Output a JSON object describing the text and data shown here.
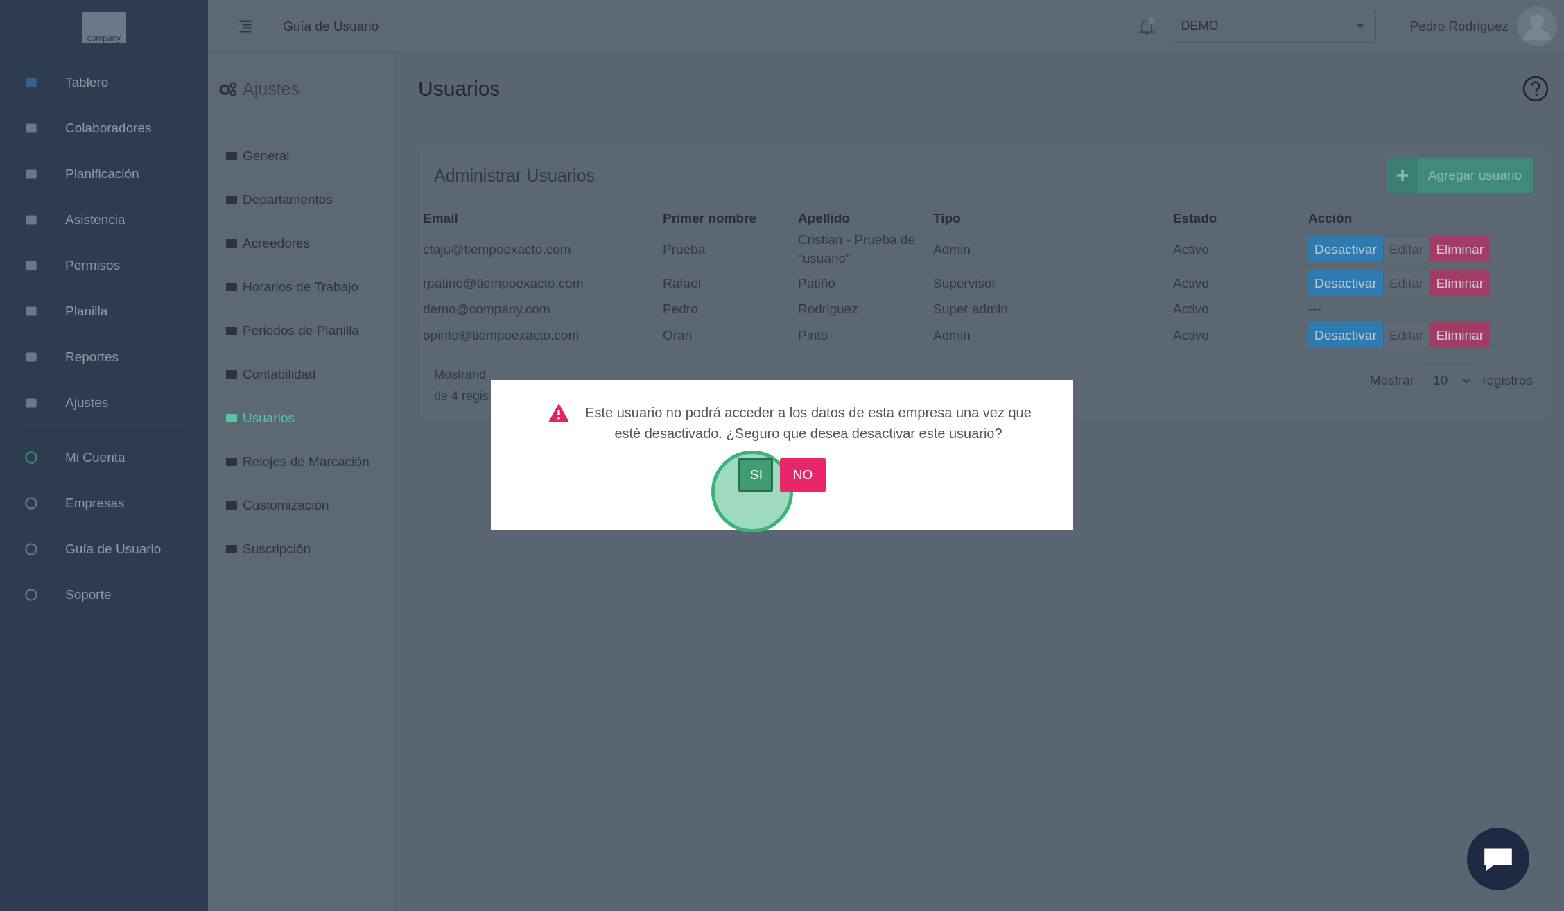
{
  "sidebar": {
    "logo": "company",
    "items": [
      {
        "label": "Tablero"
      },
      {
        "label": "Colaboradores"
      },
      {
        "label": "Planificación"
      },
      {
        "label": "Asistencia"
      },
      {
        "label": "Permisos"
      },
      {
        "label": "Planilla"
      },
      {
        "label": "Reportes"
      },
      {
        "label": "Ajustes"
      }
    ],
    "account_items": [
      {
        "label": "Mi Cuenta"
      },
      {
        "label": "Empresas"
      },
      {
        "label": "Guía de Usuario"
      },
      {
        "label": "Soporte"
      }
    ]
  },
  "topbar": {
    "link": "Guía de Usuario",
    "company_select": "DEMO",
    "user_name": "Pedro Rodriguez"
  },
  "settings_nav": {
    "title": "Ajustes",
    "items": [
      {
        "label": "General",
        "selected": false
      },
      {
        "label": "Departamentos",
        "selected": false
      },
      {
        "label": "Acreedores",
        "selected": false
      },
      {
        "label": "Horarios de Trabajo",
        "selected": false
      },
      {
        "label": "Periodos de Planilla",
        "selected": false
      },
      {
        "label": "Contabilidad",
        "selected": false
      },
      {
        "label": "Usuarios",
        "selected": true
      },
      {
        "label": "Relojes de Marcación",
        "selected": false
      },
      {
        "label": "Customización",
        "selected": false
      },
      {
        "label": "Suscripción",
        "selected": false
      }
    ]
  },
  "page_title": "Usuarios",
  "card": {
    "title": "Administrar Usuarios",
    "add_button": "Agregar usuario",
    "table": {
      "columns": [
        "Email",
        "Primer nombre",
        "Apellido",
        "Tipo",
        "Estado",
        "Acción"
      ],
      "rows": [
        {
          "email": "ctaju@tiempoexacto.com",
          "first_name": "Prueba",
          "last_name": "Cristian - Prueba de \"usuario\"",
          "type": "Admin",
          "status": "Activo",
          "actions": [
            "Desactivar",
            "Editar",
            "Eliminar"
          ]
        },
        {
          "email": "rpatino@tiempoexacto.com",
          "first_name": "Rafael",
          "last_name": "Patiño",
          "type": "Supervisor",
          "status": "Activo",
          "actions": [
            "Desactivar",
            "Editar",
            "Eliminar"
          ]
        },
        {
          "email": "demo@company.com",
          "first_name": "Pedro",
          "last_name": "Rodriguez",
          "type": "Super admin",
          "status": "Activo",
          "no_actions": "---"
        },
        {
          "email": "opinto@tiempoexacto.com",
          "first_name": "Oran",
          "last_name": "Pinto",
          "type": "Admin",
          "status": "Activo",
          "actions": [
            "Desactivar",
            "Editar",
            "Eliminar"
          ]
        }
      ]
    },
    "info_lines": [
      "Mostrand",
      "de 4 regis"
    ],
    "page_size_label": "Mostrar",
    "page_size": "10",
    "page_size_suffix": "registros"
  },
  "modal": {
    "message": "Este usuario no podrá acceder a los datos de esta empresa una vez que esté desactivado. ¿Seguro que desea desactivar este usuario?",
    "confirm": "SI",
    "cancel": "NO"
  }
}
